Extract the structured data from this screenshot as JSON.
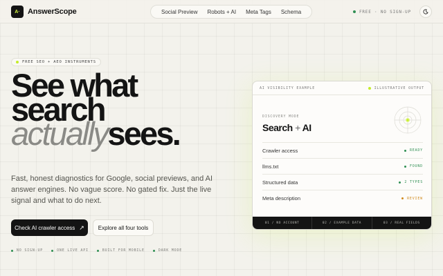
{
  "brand": {
    "logo_text": "A·",
    "name": "AnswerScope"
  },
  "nav": {
    "items": [
      "Social Preview",
      "Robots + AI",
      "Meta Tags",
      "Schema"
    ]
  },
  "header": {
    "status": "FREE · NO SIGN-UP",
    "theme_icon": "moon-icon"
  },
  "hero": {
    "pill": "FREE SEO + AEO INSTRUMENTS",
    "headline_1": "See what",
    "headline_2": "search",
    "headline_3a": "actually",
    "headline_3b": "sees.",
    "lede": "Fast, honest diagnostics for Google, social previews, and AI answer engines. No vague score. No gated fix. Just the live signal and what to do next.",
    "cta_primary": "Check AI crawler access",
    "cta_secondary": "Explore all four tools",
    "features": [
      "NO SIGN-UP",
      "ONE LIVE API",
      "BUILT FOR MOBILE",
      "DARK MODE"
    ]
  },
  "card": {
    "top_left": "AI VISIBILITY EXAMPLE",
    "top_right": "ILLUSTRATIVE OUTPUT",
    "mode_label": "DISCOVERY MODE",
    "title_a": "Search",
    "title_plus": "+",
    "title_b": "AI",
    "rows": [
      {
        "label": "Crawler access",
        "status": "READY",
        "color": "#2f8f53"
      },
      {
        "label": "llms.txt",
        "status": "FOUND",
        "color": "#2f8f53"
      },
      {
        "label": "Structured data",
        "status": "2 TYPES",
        "color": "#2f8f53"
      },
      {
        "label": "Meta description",
        "status": "REVIEW",
        "color": "#d08a1e"
      }
    ],
    "footer": [
      "01 / NO ACCOUNT",
      "02 / EXAMPLE DATA",
      "03 / REAL FIELDS"
    ]
  },
  "colors": {
    "accent": "#c4ec2a",
    "ok": "#2f8f53",
    "warn": "#d08a1e",
    "ink": "#141414"
  }
}
